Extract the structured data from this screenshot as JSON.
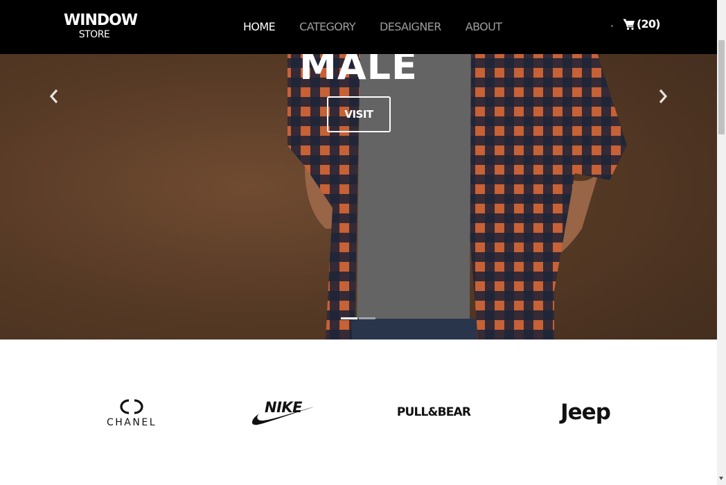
{
  "brand": {
    "main": "WINDOW",
    "sub": "STORE"
  },
  "nav": {
    "links": [
      {
        "label": "HOME",
        "active": true
      },
      {
        "label": "CATEGORY",
        "active": false
      },
      {
        "label": "DESAIGNER",
        "active": false
      },
      {
        "label": "ABOUT",
        "active": false
      }
    ]
  },
  "cart": {
    "count": "(20)",
    "icon": "cart-icon"
  },
  "hero": {
    "title": "MALE",
    "button_label": "VISIT",
    "prev_icon": "chevron-left-icon",
    "next_icon": "chevron-right-icon",
    "slides": 2,
    "active_slide": 1
  },
  "brands": [
    {
      "name": "chanel",
      "text": "CHANEL"
    },
    {
      "name": "nike",
      "text": "NIKE"
    },
    {
      "name": "pull-and-bear",
      "text": "PULL&BEAR"
    },
    {
      "name": "jeep",
      "text": "Jeep"
    }
  ],
  "colors": {
    "navbar_bg": "#000000",
    "nav_active": "#ffffff",
    "nav_inactive": "#9d9d9d",
    "hero_bg": "#5e3f29"
  }
}
